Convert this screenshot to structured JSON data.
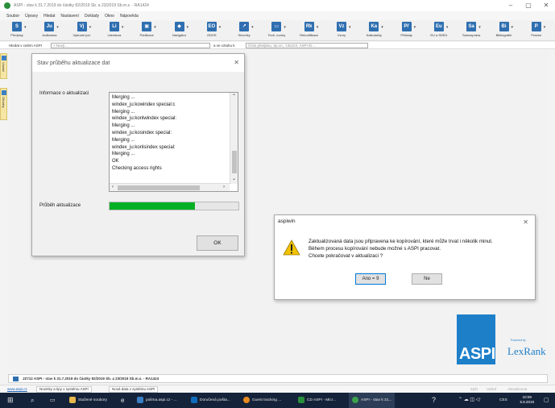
{
  "window": {
    "title": "ASPI - stav k 31.7.2019 do částky 82/2019 Sb. a 23/2019 Sb.m.s. - RA1424",
    "controls": [
      "–",
      "▢",
      "✕"
    ]
  },
  "menu": [
    "Soubor",
    "Úpravy",
    "Hledat",
    "Nastavení",
    "Doklady",
    "Okno",
    "Nápověda"
  ],
  "ribbon": [
    {
      "label": "Předpisy",
      "icon": "S",
      "color": "#2f6fb0"
    },
    {
      "label": "Judikatura",
      "icon": "Ju",
      "color": "#2f6fb0"
    },
    {
      "label": "Vybrané jud.",
      "icon": "Vj",
      "color": "#2f6fb0"
    },
    {
      "label": "Literatura",
      "icon": "Li",
      "color": "#2f6fb0"
    },
    {
      "label": "Publikace",
      "icon": "▣",
      "color": "#2f6fb0"
    },
    {
      "label": "Navigátor",
      "icon": "◆",
      "color": "#2f6fb0"
    },
    {
      "label": "ODHS",
      "icon": "EO",
      "color": "#2f6fb0"
    },
    {
      "label": "Slovníky",
      "icon": "↗",
      "color": "#2f6fb0"
    },
    {
      "label": "Tech. normy",
      "icon": "▭",
      "color": "#2f6fb0"
    },
    {
      "label": "Rekodifikace",
      "icon": "Rk",
      "color": "#2f6fb0"
    },
    {
      "label": "Vzory",
      "icon": "Vz",
      "color": "#2f6fb0"
    },
    {
      "label": "Kalkulačky",
      "icon": "Ka",
      "color": "#2f6fb0"
    },
    {
      "label": "Příklady",
      "icon": "Př",
      "color": "#2f6fb0"
    },
    {
      "label": "EU a SDEU",
      "icon": "Eu",
      "color": "#2f6fb0"
    },
    {
      "label": "Samospráva",
      "icon": "Sa",
      "color": "#2f6fb0"
    },
    {
      "label": "Bibliografie",
      "icon": "Bi",
      "color": "#2f6fb0"
    },
    {
      "label": "Pravtor",
      "icon": "P",
      "color": "#2f6fb0"
    }
  ],
  "search": {
    "label": "Hledat v celém ASPI",
    "placeholder": "+ Nový...",
    "mid_label": "a ve vztahu k",
    "second_placeholder": "Číslo předpisu, Sp.zn., CELEX, ASPI ID ..."
  },
  "side_tabs": [
    "Vlastní",
    "Obsahy"
  ],
  "progress_dialog": {
    "title": "Stav průběhu aktualizace dat",
    "close": "✕",
    "info_label": "Informace o aktualizaci",
    "log_lines": [
      "Merging ...",
      "windex_ju:kowindex special:c",
      "Merging ...",
      "windex_ju:konlwindex special:",
      "Merging ...",
      "windex_ju:kosindex special:",
      "Merging ...",
      "windex_ju:konlsindex special:",
      "Merging ...",
      " OK",
      "Checking access rights"
    ],
    "progress_label": "Průběh aktualizace",
    "progress_percent": 66,
    "progress_color": "#06b025",
    "ok_label": "OK"
  },
  "confirm_dialog": {
    "title": "aspiwin",
    "close": "✕",
    "message": [
      "Zaktualizovaná data jsou připravena ke kopírování, které může trvat i několik minut.",
      "Během procesu kopírování nebude možné s ASPI pracovat.",
      "Chcete pokračovat v aktualizaci ?"
    ],
    "yes_label": "Ano = 9",
    "no_label": "Ne"
  },
  "logo": {
    "text": "ASPI",
    "powered": "Powered by",
    "partner": "LexRank",
    "color": "#1e7fc9"
  },
  "status": {
    "text": "JZ712 ASPI - stav k 31.7.2019 do částky 82/2019 Sb. a 23/2019 Sb.m.s. - RA1424"
  },
  "news": {
    "link": "www.aspi.cz",
    "items": [
      "Novinky a tipy v systému ASPI",
      "Nová data v systému ASPI"
    ],
    "right": [
      "Zpět",
      "Vpřed",
      "Aktualizovat"
    ]
  },
  "taskbar": {
    "apps": [
      "Stažené soubory",
      "polima.aspi.cz - ...",
      "Doručená pošta...",
      "Guest tracking ...",
      "CD ASPI - Micr...",
      "ASPI - stav k 31..."
    ],
    "lang": "CES",
    "time": "10:09",
    "date": "5.8.2019"
  }
}
